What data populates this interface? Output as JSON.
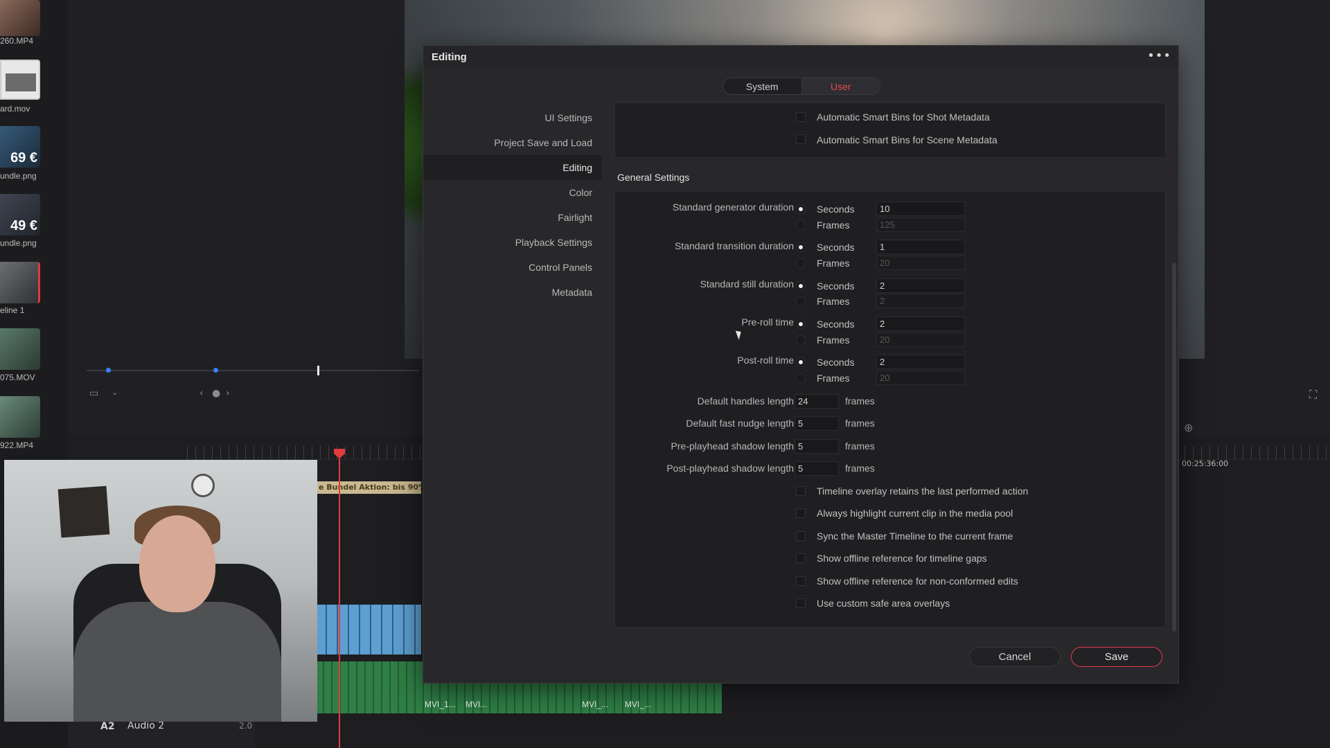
{
  "background": {
    "media_items": [
      {
        "label": "260.MP4",
        "price": ""
      },
      {
        "label": "ard.mov",
        "price": ""
      },
      {
        "label": "undle.png",
        "price": "69 €"
      },
      {
        "label": "undle.png",
        "price": "49 €"
      },
      {
        "label": "eline 1",
        "price": ""
      },
      {
        "label": "075.MOV",
        "price": ""
      },
      {
        "label": "922.MP4",
        "price": ""
      }
    ],
    "title_clip": "e Bundel Aktion: bis 90%",
    "audio_clip_labels": [
      "MVI_1...",
      "MVI...",
      "MVI_...",
      "MVI_..."
    ],
    "track": {
      "id": "A2",
      "name": "Audio 2",
      "channels": "2.0"
    },
    "timecode_right": "00:25:36:00"
  },
  "dialog": {
    "title": "Editing",
    "options_glyph": "•••",
    "tabs": [
      {
        "label": "System",
        "active": false
      },
      {
        "label": "User",
        "active": true
      }
    ],
    "nav": [
      {
        "label": "UI Settings",
        "active": false
      },
      {
        "label": "Project Save and Load",
        "active": false
      },
      {
        "label": "Editing",
        "active": true
      },
      {
        "label": "Color",
        "active": false
      },
      {
        "label": "Fairlight",
        "active": false
      },
      {
        "label": "Playback Settings",
        "active": false
      },
      {
        "label": "Control Panels",
        "active": false
      },
      {
        "label": "Metadata",
        "active": false
      }
    ],
    "smart_bins": [
      {
        "label": "Automatic Smart Bins for Shot Metadata",
        "checked": false
      },
      {
        "label": "Automatic Smart Bins for Scene Metadata",
        "checked": false
      }
    ],
    "section_title": "General Settings",
    "durations": [
      {
        "label": "Standard generator duration",
        "selected": "Seconds",
        "seconds_value": "10",
        "frames_value": "125"
      },
      {
        "label": "Standard transition duration",
        "selected": "Seconds",
        "seconds_value": "1",
        "frames_value": "20"
      },
      {
        "label": "Standard still duration",
        "selected": "Seconds",
        "seconds_value": "2",
        "frames_value": "2"
      },
      {
        "label": "Pre-roll time",
        "selected": "Seconds",
        "seconds_value": "2",
        "frames_value": "20"
      },
      {
        "label": "Post-roll time",
        "selected": "Seconds",
        "seconds_value": "2",
        "frames_value": "20"
      }
    ],
    "option_seconds": "Seconds",
    "option_frames": "Frames",
    "frame_settings": [
      {
        "label": "Default handles length",
        "value": "24",
        "unit": "frames"
      },
      {
        "label": "Default fast nudge length",
        "value": "5",
        "unit": "frames"
      },
      {
        "label": "Pre-playhead shadow length",
        "value": "5",
        "unit": "frames"
      },
      {
        "label": "Post-playhead shadow length",
        "value": "5",
        "unit": "frames"
      }
    ],
    "checkboxes": [
      {
        "label": "Timeline overlay retains the last performed action",
        "checked": false
      },
      {
        "label": "Always highlight current clip in the media pool",
        "checked": false
      },
      {
        "label": "Sync the Master Timeline to the current frame",
        "checked": false
      },
      {
        "label": "Show offline reference for timeline gaps",
        "checked": false
      },
      {
        "label": "Show offline reference for non-conformed edits",
        "checked": false
      },
      {
        "label": "Use custom safe area overlays",
        "checked": false
      }
    ],
    "buttons": {
      "cancel": "Cancel",
      "save": "Save"
    },
    "accent_color": "#e2394a"
  }
}
